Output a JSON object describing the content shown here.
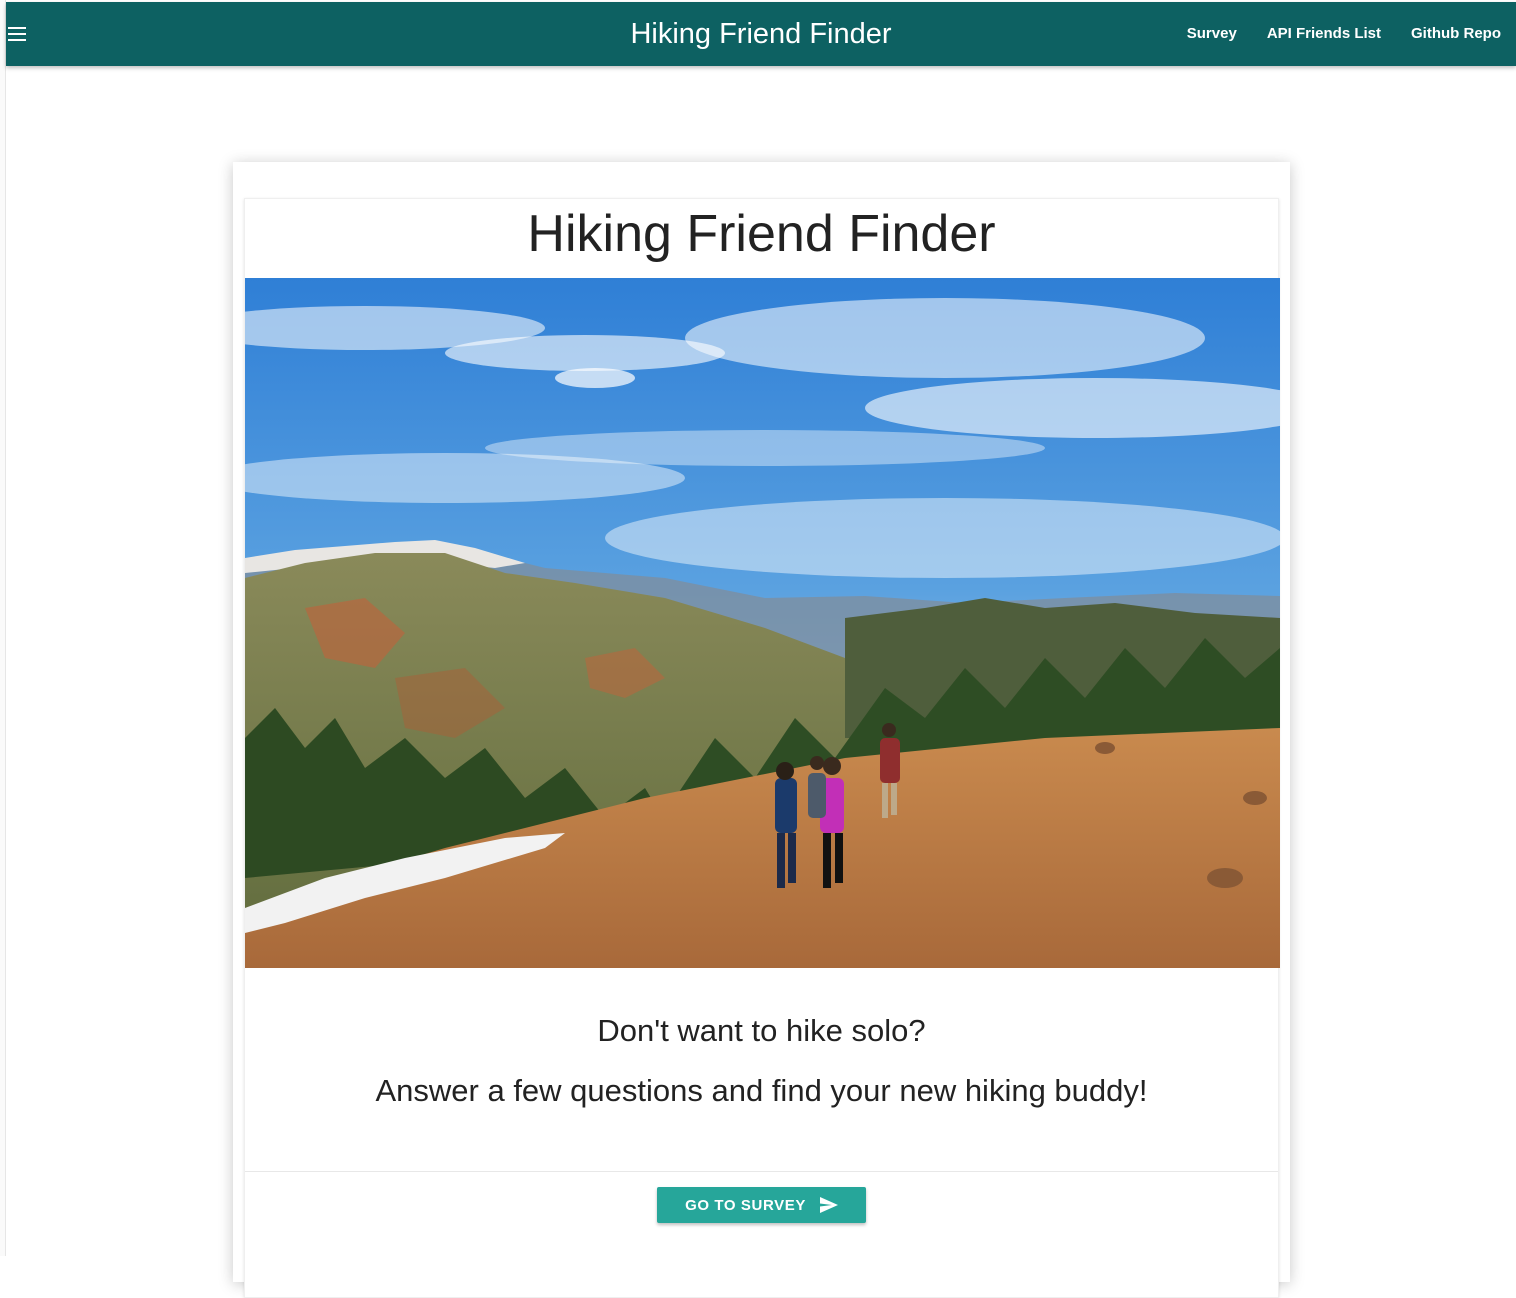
{
  "navbar": {
    "brand": "Hiking Friend Finder",
    "menu_icon": "hamburger-menu-icon",
    "links": [
      "Survey",
      "API Friends List",
      "Github Repo"
    ]
  },
  "card": {
    "title": "Hiking Friend Finder",
    "hero_image": "hikers-on-mountain-trail-photo",
    "line1": "Don't want to hike solo?",
    "line2": "Answer a few questions and find your new hiking buddy!",
    "button_label": "GO TO SURVEY",
    "button_icon": "send-icon"
  },
  "colors": {
    "nav_bg": "#0d6162",
    "button_bg": "#26a69a"
  }
}
